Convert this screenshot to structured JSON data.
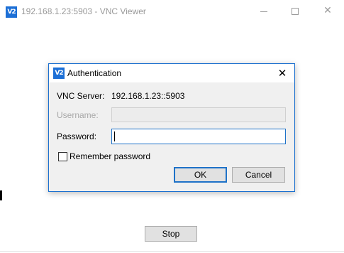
{
  "window": {
    "title": "192.168.1.23:5903 - VNC Viewer",
    "app_icon": "vnc-logo-icon",
    "logo_text": "V2",
    "close_glyph": "✕"
  },
  "main": {
    "stop_label": "Stop"
  },
  "dialog": {
    "title": "Authentication",
    "logo_text": "V2",
    "close_glyph": "✕",
    "server_label": "VNC Server:",
    "server_value": "192.168.1.23::5903",
    "username_label": "Username:",
    "username_value": "",
    "password_label": "Password:",
    "password_value": "",
    "remember_label": "Remember password",
    "remember_checked": false,
    "ok_label": "OK",
    "cancel_label": "Cancel"
  },
  "colors": {
    "accent": "#1e72c8",
    "logo_blue": "#1c6fd6",
    "dialog_background": "#f0f0f0",
    "disabled_text": "#a8a8a8"
  }
}
